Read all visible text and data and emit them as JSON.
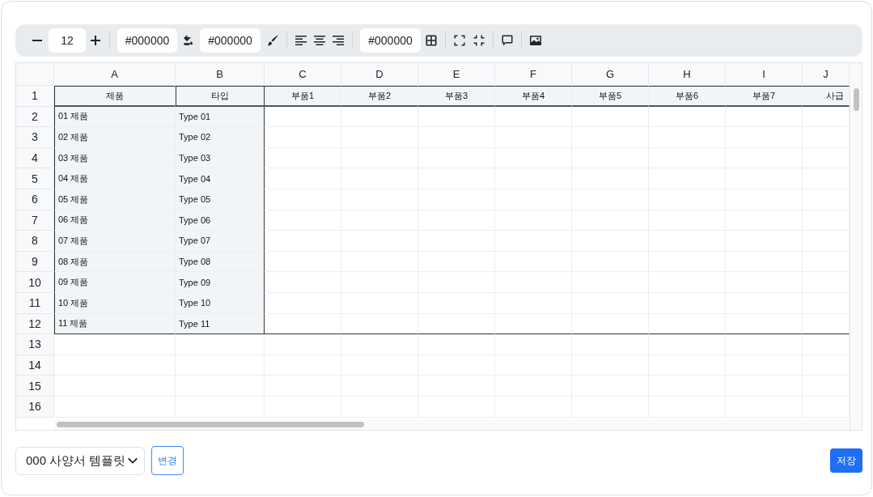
{
  "toolbar": {
    "font_size": "12",
    "text_color": "#000000",
    "fill_color": "#000000",
    "border_color": "#000000"
  },
  "sheet": {
    "columns": [
      "A",
      "B",
      "C",
      "D",
      "E",
      "F",
      "G",
      "H",
      "I",
      "J"
    ],
    "rows": [
      {
        "number": "1",
        "kind": "header",
        "cells": [
          "제품",
          "타입",
          "부품1",
          "부품2",
          "부품3",
          "부품4",
          "부품5",
          "부품6",
          "부품7",
          "사급"
        ]
      },
      {
        "number": "2",
        "kind": "data",
        "cells": [
          "01 제품",
          "Type 01"
        ]
      },
      {
        "number": "3",
        "kind": "data",
        "cells": [
          "02 제품",
          "Type 02"
        ]
      },
      {
        "number": "4",
        "kind": "data",
        "cells": [
          "03 제품",
          "Type 03"
        ]
      },
      {
        "number": "5",
        "kind": "data",
        "cells": [
          "04 제품",
          "Type 04"
        ]
      },
      {
        "number": "6",
        "kind": "data",
        "cells": [
          "05 제품",
          "Type 05"
        ]
      },
      {
        "number": "7",
        "kind": "data",
        "cells": [
          "06 제품",
          "Type 06"
        ]
      },
      {
        "number": "8",
        "kind": "data",
        "cells": [
          "07 제품",
          "Type 07"
        ]
      },
      {
        "number": "9",
        "kind": "data",
        "cells": [
          "08 제품",
          "Type 08"
        ]
      },
      {
        "number": "10",
        "kind": "data",
        "cells": [
          "09 제품",
          "Type 09"
        ]
      },
      {
        "number": "11",
        "kind": "data",
        "cells": [
          "10 제품",
          "Type 10"
        ]
      },
      {
        "number": "12",
        "kind": "data",
        "cells": [
          "11 제품",
          "Type 11"
        ]
      },
      {
        "number": "13",
        "kind": "empty",
        "cells": []
      },
      {
        "number": "14",
        "kind": "empty",
        "cells": []
      },
      {
        "number": "15",
        "kind": "empty",
        "cells": []
      },
      {
        "number": "16",
        "kind": "empty",
        "cells": []
      }
    ]
  },
  "footer": {
    "template_select": "000 사양서 템플릿",
    "change_button": "변경",
    "save_button": "저장"
  }
}
